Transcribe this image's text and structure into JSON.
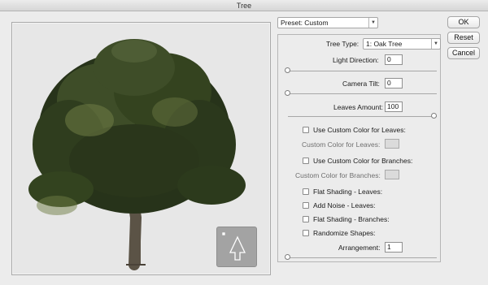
{
  "window": {
    "title": "Tree"
  },
  "preset": {
    "label": "Preset: Custom"
  },
  "buttons": {
    "ok": "OK",
    "reset": "Reset",
    "cancel": "Cancel"
  },
  "tree_type": {
    "label": "Tree Type:",
    "value": "1: Oak Tree"
  },
  "light_direction": {
    "label": "Light Direction:",
    "value": "0"
  },
  "camera_tilt": {
    "label": "Camera Tilt:",
    "value": "0"
  },
  "leaves_amount": {
    "label": "Leaves Amount:",
    "value": "100"
  },
  "leaves_color": {
    "checkbox_label": "Use Custom Color for Leaves:",
    "swatch_label": "Custom Color for Leaves:",
    "checked": false
  },
  "branches_color": {
    "checkbox_label": "Use Custom Color for Branches:",
    "swatch_label": "Custom Color for Branches:",
    "checked": false
  },
  "options": [
    {
      "label": "Flat Shading - Leaves:",
      "checked": false
    },
    {
      "label": "Add Noise - Leaves:",
      "checked": false
    },
    {
      "label": "Flat Shading - Branches:",
      "checked": false
    },
    {
      "label": "Randomize Shapes:",
      "checked": false
    }
  ],
  "arrangement": {
    "label": "Arrangement:",
    "value": "1"
  },
  "colors": {
    "foliage_dark": "#27331a",
    "foliage_mid": "#3e4d28",
    "foliage_light": "#6f7d45",
    "trunk": "#5b5346",
    "tool_bg": "#a3a3a3"
  },
  "icons": {
    "tree_tool": "tree-outline-icon",
    "cursor": "crosshair-icon"
  }
}
